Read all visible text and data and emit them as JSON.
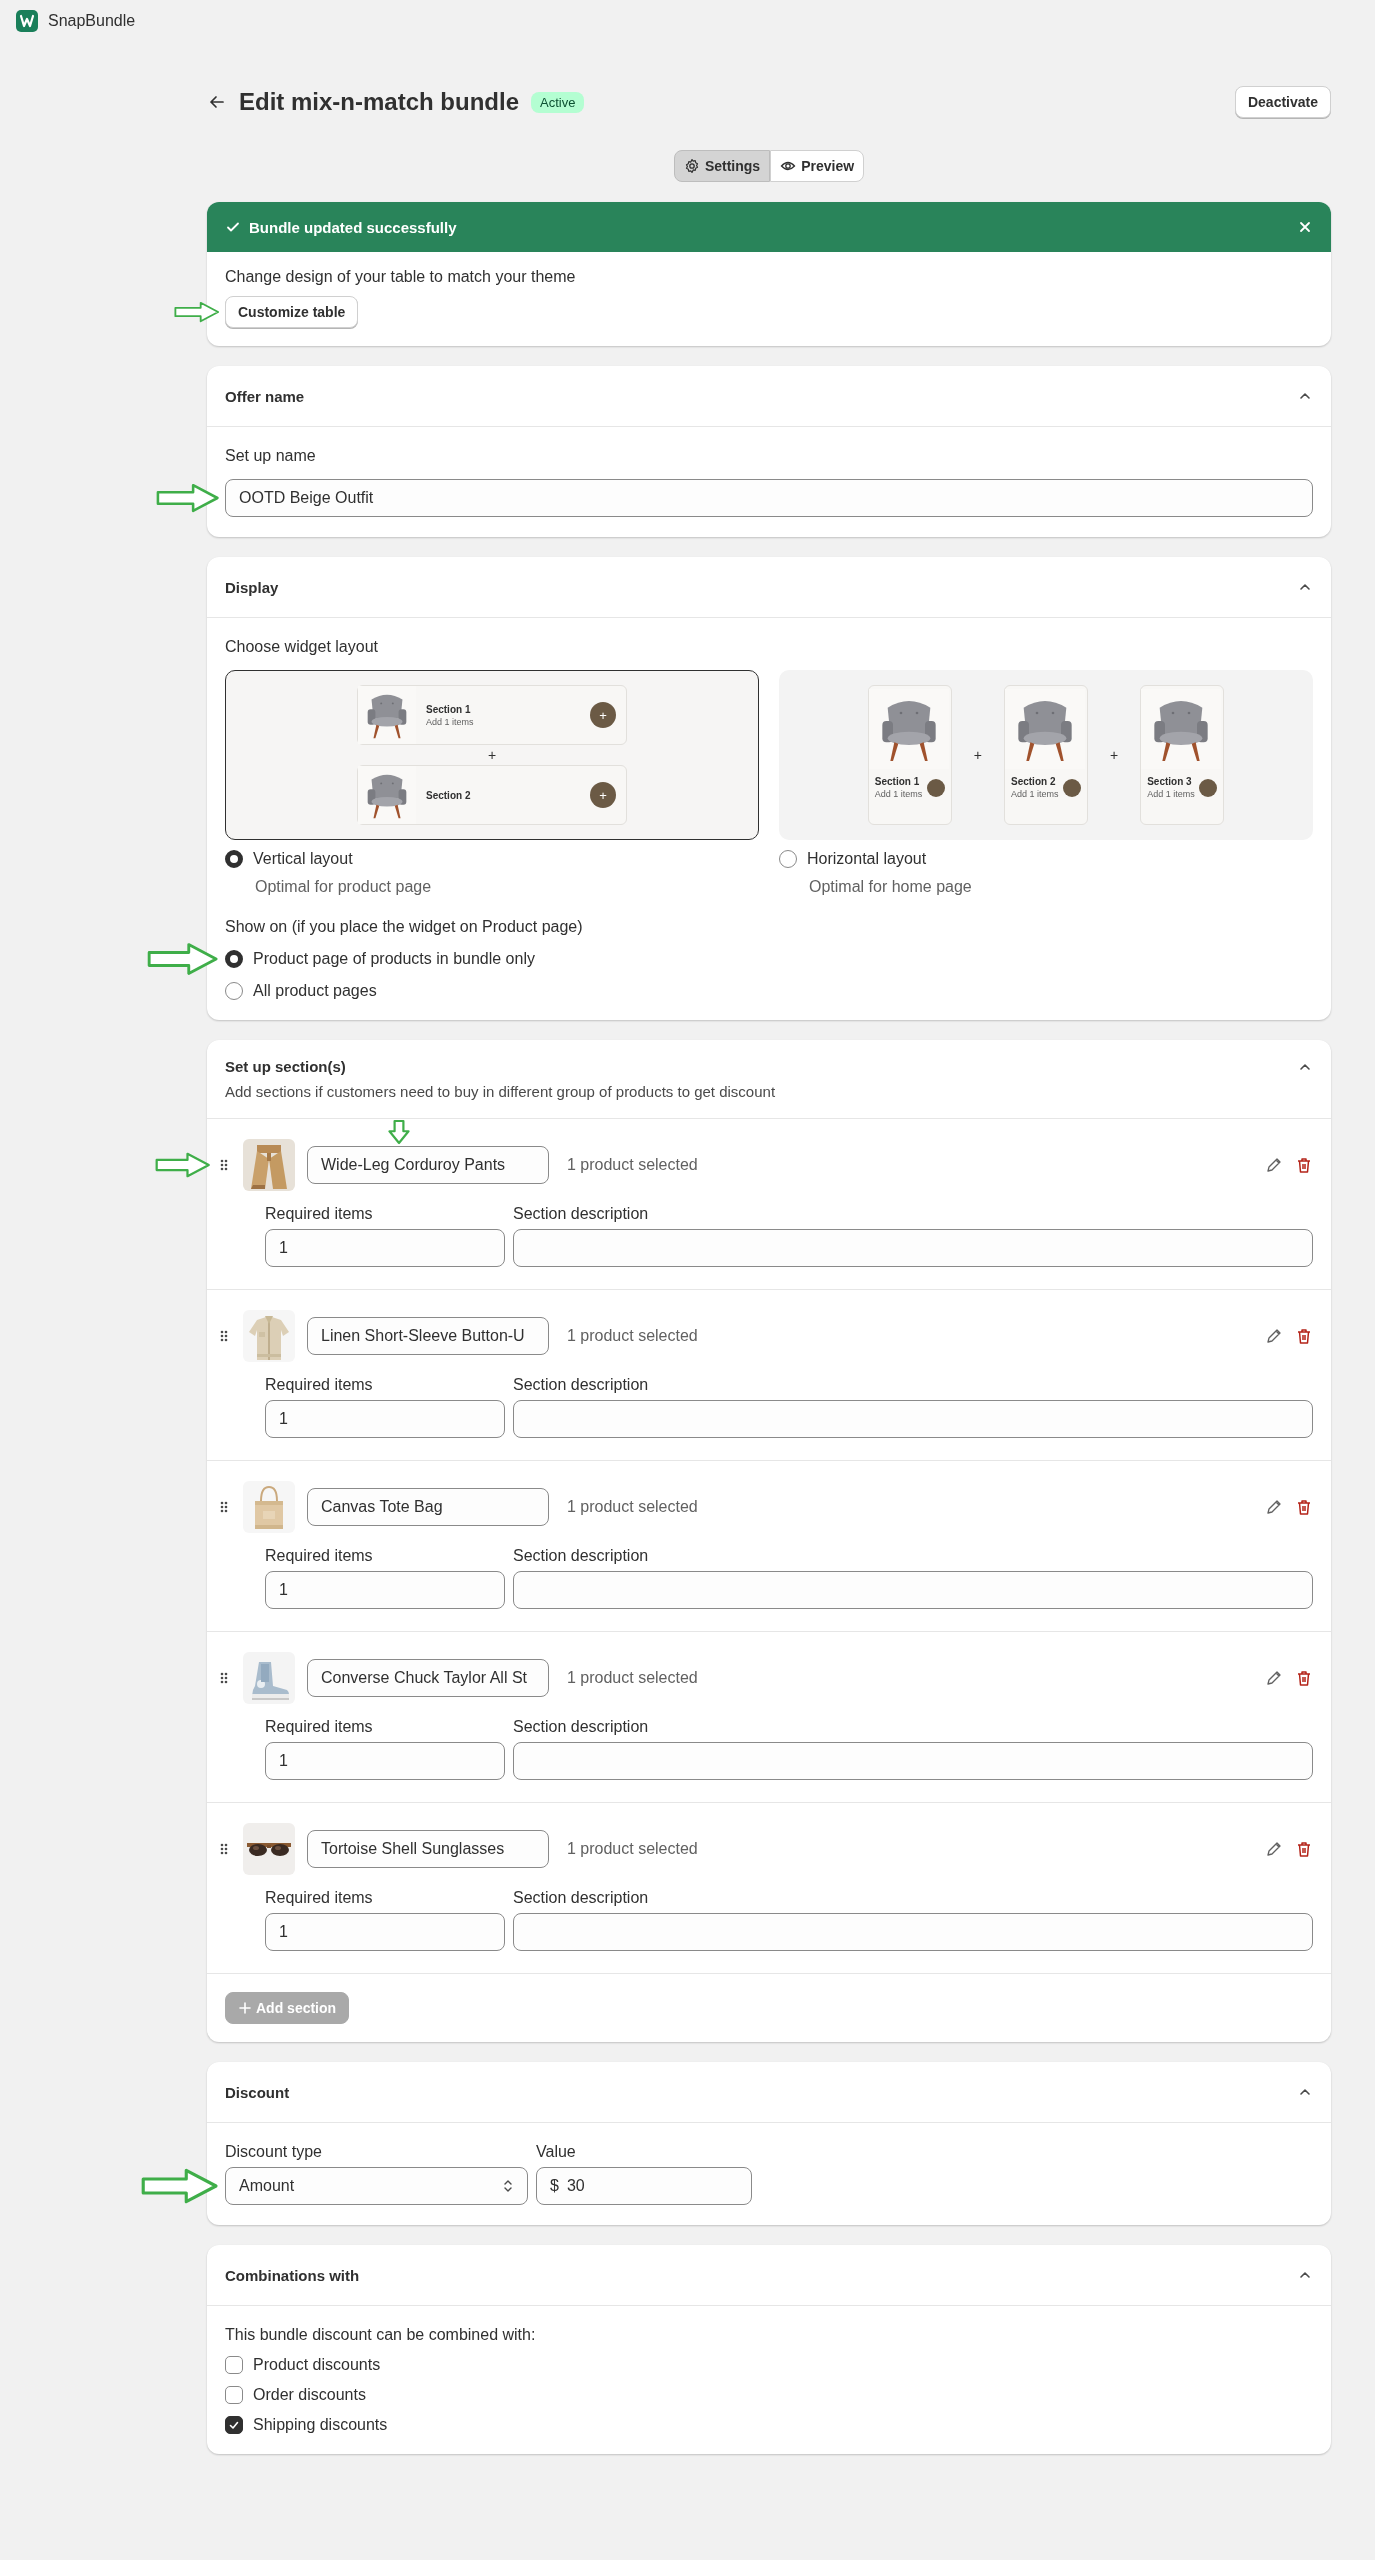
{
  "app": {
    "name": "SnapBundle"
  },
  "header": {
    "title": "Edit mix-n-match bundle",
    "status": "Active",
    "action": "Deactivate"
  },
  "tabs": [
    {
      "label": "Settings",
      "selected": true
    },
    {
      "label": "Preview",
      "selected": false
    }
  ],
  "banner": {
    "title": "Bundle updated successfully",
    "message": "Change design of your table to match your theme",
    "button": "Customize table",
    "marked": true
  },
  "offer_name": {
    "title": "Offer name",
    "expanded": true,
    "label": "Set up name",
    "value": "OOTD Beige Outfit",
    "marked": true
  },
  "display": {
    "title": "Display",
    "expanded": true,
    "layout_label": "Choose widget layout",
    "layouts": [
      {
        "kind": "vertical",
        "label": "Vertical layout",
        "description": "Optimal for product page",
        "selected": true,
        "joiner": "+",
        "preview": [
          {
            "title": "Section 1",
            "note": "Add 1 items",
            "add": "+"
          },
          {
            "title": "Section 2",
            "add": "+"
          }
        ]
      },
      {
        "kind": "horizontal",
        "label": "Horizontal layout",
        "description": "Optimal for home page",
        "selected": false,
        "joiner": "+",
        "preview": [
          {
            "title": "Section 1",
            "note": "Add 1 items"
          },
          {
            "title": "Section 2",
            "note": "Add 1 items"
          },
          {
            "title": "Section 3",
            "note": "Add 1 items"
          }
        ]
      }
    ],
    "show_on_label": "Show on (if you place the widget on Product page)",
    "show_on": [
      {
        "label": "Product page of products in bundle only",
        "selected": true,
        "marked": true
      },
      {
        "label": "All product pages",
        "selected": false,
        "marked": false
      }
    ]
  },
  "sections": {
    "title": "Set up section(s)",
    "description": "Add sections if customers need to buy in different group of products to get discount",
    "expanded": true,
    "items": [
      {
        "name": "Wide-Leg Corduroy Pants",
        "status": "1 product selected",
        "required_label": "Required items",
        "required": "1",
        "description_label": "Section description",
        "marked": true,
        "name_marked": true
      },
      {
        "name": "Linen Short-Sleeve Button-U",
        "status": "1 product selected",
        "required_label": "Required items",
        "required": "1",
        "description_label": "Section description",
        "marked": false,
        "name_marked": false
      },
      {
        "name": "Canvas Tote Bag",
        "status": "1 product selected",
        "required_label": "Required items",
        "required": "1",
        "description_label": "Section description",
        "marked": false,
        "name_marked": false
      },
      {
        "name": "Converse Chuck Taylor All St",
        "status": "1 product selected",
        "required_label": "Required items",
        "required": "1",
        "description_label": "Section description",
        "marked": false,
        "name_marked": false
      },
      {
        "name": "Tortoise Shell Sunglasses",
        "status": "1 product selected",
        "required_label": "Required items",
        "required": "1",
        "description_label": "Section description",
        "marked": false,
        "name_marked": false
      }
    ],
    "add_button": {
      "label": "Add section",
      "disabled": true
    }
  },
  "discount": {
    "title": "Discount",
    "expanded": true,
    "type_label": "Discount type",
    "type_value": "Amount",
    "value_label": "Value",
    "currency": "$",
    "value": "30",
    "marked": true
  },
  "combinations": {
    "title": "Combinations with",
    "expanded": true,
    "intro": "This bundle discount can be combined with:",
    "options": [
      {
        "label": "Product discounts",
        "checked": false
      },
      {
        "label": "Order discounts",
        "checked": false
      },
      {
        "label": "Shipping discounts",
        "checked": true
      }
    ]
  }
}
